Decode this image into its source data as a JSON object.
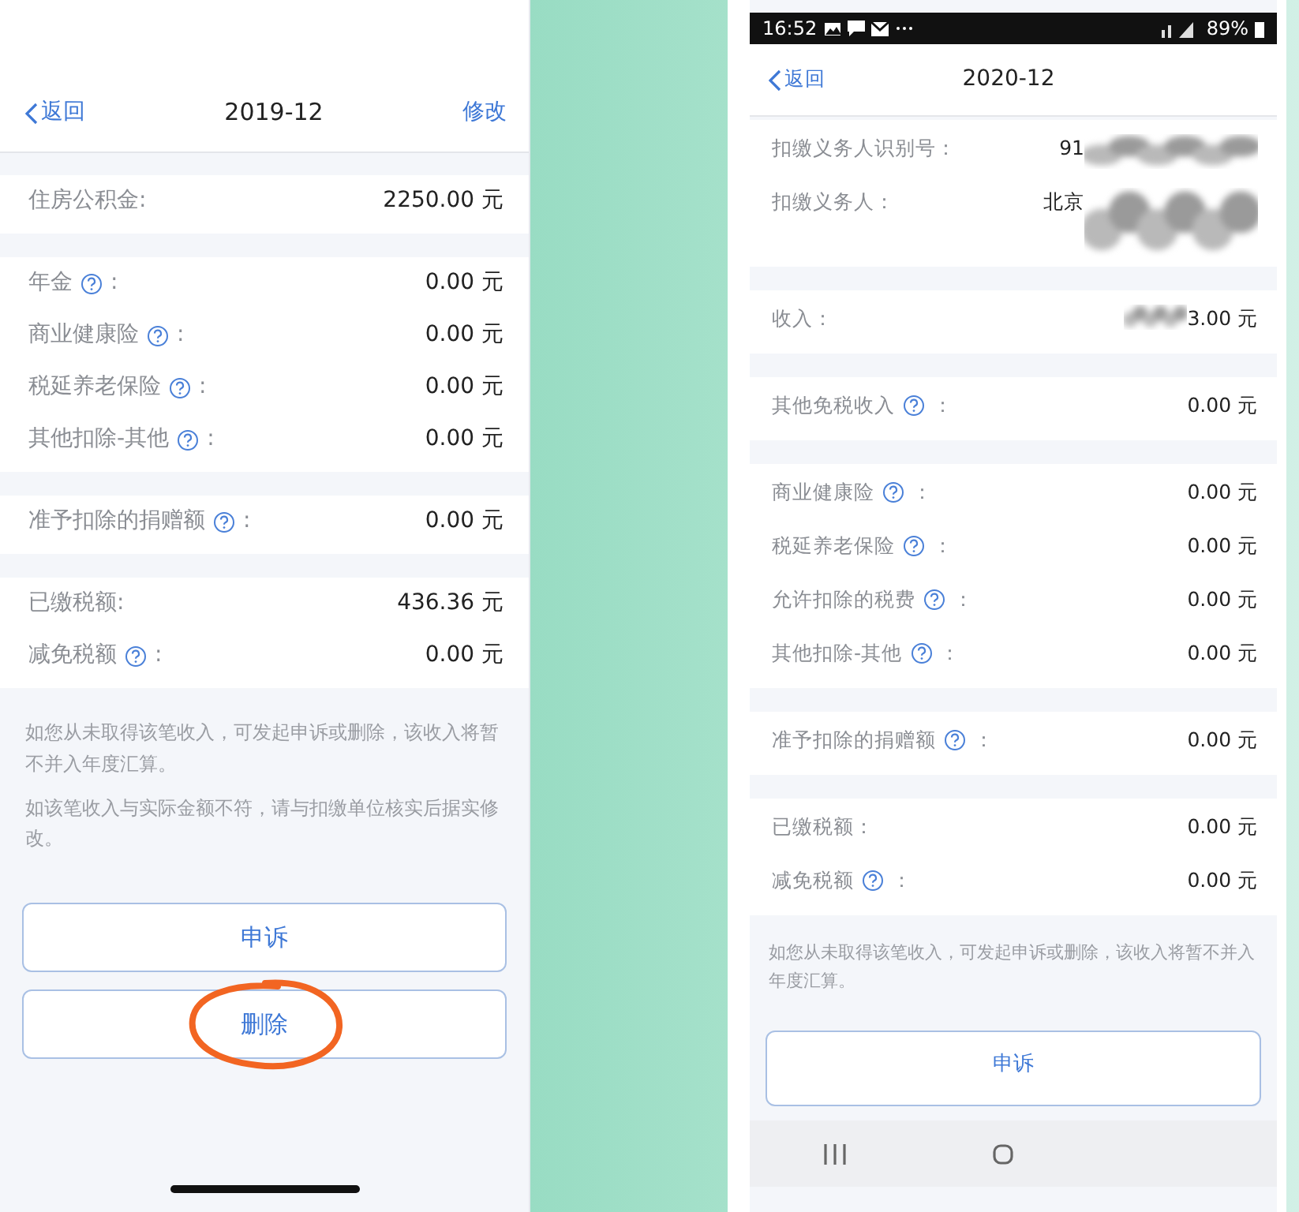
{
  "screens": [
    {
      "kind": "iphone",
      "nav": {
        "back": "返回",
        "title": "2019-12",
        "action": "修改"
      },
      "sections": [
        {
          "rows": [
            {
              "label": "住房公积金:",
              "value": "2250.00 元",
              "help": false
            }
          ]
        },
        {
          "rows": [
            {
              "label": "年金",
              "help": true,
              "colon": ":",
              "value": "0.00 元"
            },
            {
              "label": "商业健康险",
              "help": true,
              "colon": ":",
              "value": "0.00 元"
            },
            {
              "label": "税延养老保险",
              "help": true,
              "colon": " :",
              "value": "0.00 元"
            },
            {
              "label": "其他扣除-其他",
              "help": true,
              "colon": ":",
              "value": "0.00 元"
            }
          ]
        },
        {
          "rows": [
            {
              "label": "准予扣除的捐赠额",
              "help": true,
              "colon": ":",
              "value": "0.00 元"
            }
          ]
        },
        {
          "rows": [
            {
              "label": "已缴税额:",
              "help": false,
              "value": "436.36 元"
            },
            {
              "label": "减免税额",
              "help": true,
              "colon": ":",
              "value": "0.00 元"
            }
          ]
        }
      ],
      "notes": [
        "如您从未取得该笔收入，可发起申诉或删除，该收入将暂不并入年度汇算。",
        "如该笔收入与实际金额不符，请与扣缴单位核实后据实修改。"
      ],
      "buttons": [
        {
          "label": "申诉",
          "circled": false
        },
        {
          "label": "删除",
          "circled": true
        }
      ]
    },
    {
      "kind": "android",
      "status_bar": {
        "time": "16:52",
        "battery": "89%"
      },
      "nav": {
        "back": "返回",
        "title": "2020-12"
      },
      "sections": [
        {
          "rows": [
            {
              "label": "扣缴义务人识别号：",
              "help": false,
              "value": "91",
              "kind": "code"
            },
            {
              "label": "扣缴义务人：",
              "help": false,
              "value": "北京",
              "kind": "payer"
            }
          ]
        },
        {
          "rows": [
            {
              "label": "收入：",
              "help": false,
              "value": "3.00 元",
              "kind": "income"
            }
          ]
        },
        {
          "rows": [
            {
              "label": "其他免税收入",
              "help": true,
              "colon": " ：",
              "value": "0.00 元"
            }
          ]
        },
        {
          "rows": [
            {
              "label": "商业健康险",
              "help": true,
              "colon": " ：",
              "value": "0.00 元"
            },
            {
              "label": "税延养老保险",
              "help": true,
              "colon": " ：",
              "value": "0.00 元"
            },
            {
              "label": "允许扣除的税费",
              "help": true,
              "colon": " ：",
              "value": "0.00 元"
            },
            {
              "label": "其他扣除-其他",
              "help": true,
              "colon": " ：",
              "value": "0.00 元"
            }
          ]
        },
        {
          "rows": [
            {
              "label": "准予扣除的捐赠额",
              "help": true,
              "colon": " ：",
              "value": "0.00 元"
            }
          ]
        },
        {
          "rows": [
            {
              "label": "已缴税额：",
              "help": false,
              "value": "0.00 元"
            },
            {
              "label": "减免税额",
              "help": true,
              "colon": " ：",
              "value": "0.00 元"
            }
          ]
        }
      ],
      "notes": [
        "如您从未取得该笔收入，可发起申诉或删除，该收入将暂不并入年度汇算。"
      ],
      "buttons": [
        {
          "label": "申诉",
          "circled": false
        }
      ]
    }
  ]
}
